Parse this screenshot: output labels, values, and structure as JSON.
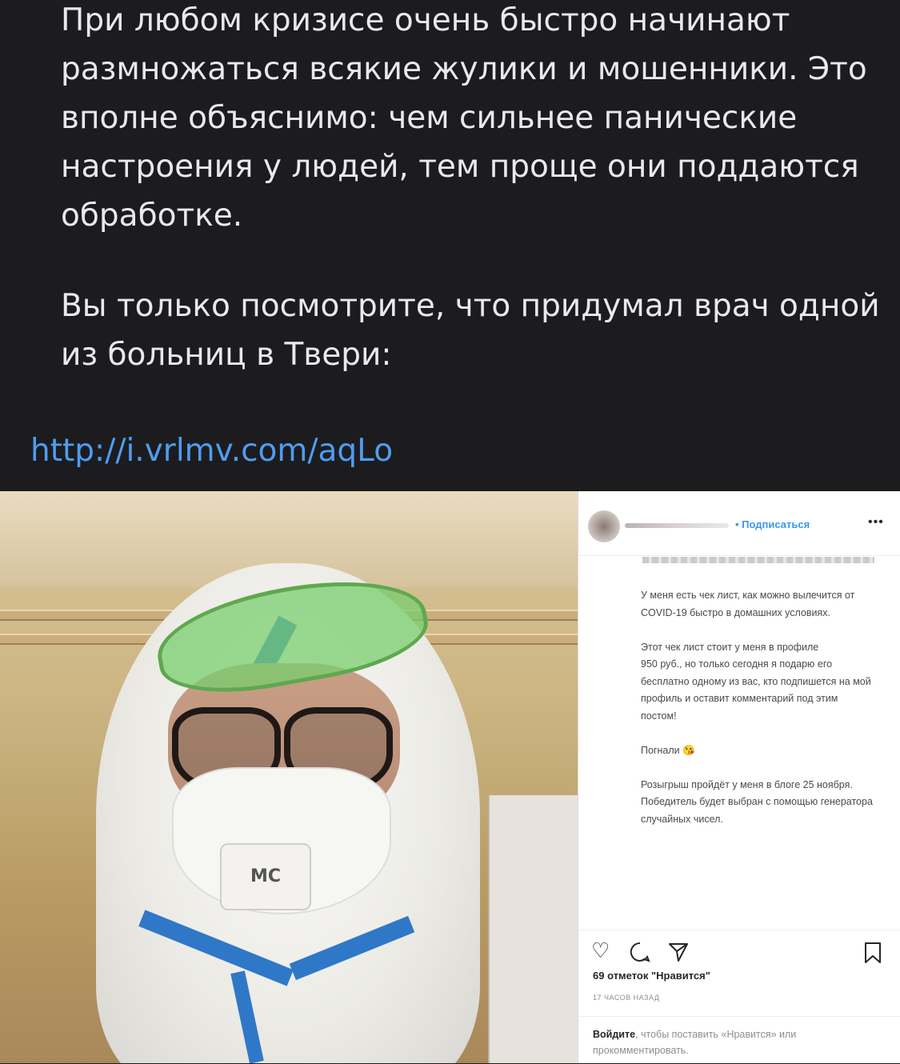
{
  "post": {
    "paragraph1": "При любом кризисе очень быстро начинают размножаться всякие жулики и мошенники. Это вполне объяснимо: чем сильнее панические настроения у людей, тем проще они поддаются обработке.",
    "paragraph2": "Вы только посмотрите, что придумал врач одной из больниц в Твери:",
    "link": "http://i.vrlmv.com/aqLo"
  },
  "photo": {
    "valve_text": "МС"
  },
  "instagram": {
    "follow_label": "• Подписаться",
    "more_label": "•••",
    "caption": [
      "У меня есть чек лист, как можно вылечится от COVID-19 быстро в домашних условиях.",
      "Этот чек лист стоит у меня в профиле\n950 руб., но только сегодня я подарю его бесплатно одному из вас, кто подпишется на мой профиль и оставит комментарий под этим постом!",
      "Погнали 😘",
      "Розыгрыш пройдёт у меня в блоге 25 ноября. Победитель будет выбран с помощью генератора случайных чисел."
    ],
    "icons": {
      "like": "heart-icon",
      "comment": "comment-icon",
      "share": "share-icon",
      "save": "bookmark-icon"
    },
    "likes": "69 отметок \"Нравится\"",
    "time": "17 ЧАСОВ НАЗАД",
    "login_link": "Войдите",
    "login_rest": ", чтобы поставить «Нравится» или прокомментировать."
  },
  "colors": {
    "background": "#1c1c1e",
    "text": "#e9e9eb",
    "link": "#4f9cf0",
    "instagram_blue": "#3897f0"
  }
}
